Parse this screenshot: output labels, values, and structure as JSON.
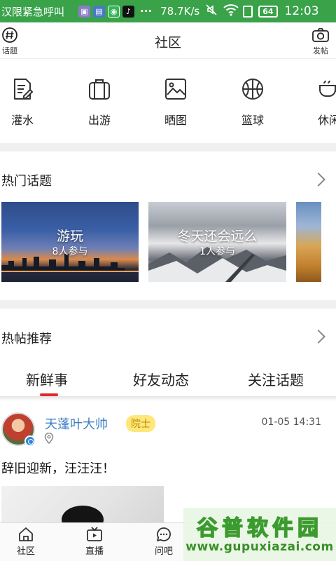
{
  "status_bar": {
    "ticker": "汉限紧急呼叫",
    "dots": "···",
    "speed": "78.7K/s",
    "battery": "64",
    "time": "12:03"
  },
  "header": {
    "title": "社区",
    "left_label": "话题",
    "right_label": "发帖"
  },
  "categories": [
    {
      "label": "灌水",
      "icon": "note-edit-icon"
    },
    {
      "label": "出游",
      "icon": "suitcase-icon"
    },
    {
      "label": "晒图",
      "icon": "image-icon"
    },
    {
      "label": "篮球",
      "icon": "basketball-icon"
    },
    {
      "label": "休闲",
      "icon": "cup-icon"
    }
  ],
  "hot_topics": {
    "title": "热门话题",
    "cards": [
      {
        "title": "游玩",
        "count": "8人参与"
      },
      {
        "title": "冬天还会远么",
        "count": "1人参与"
      }
    ]
  },
  "hot_posts": {
    "title": "热帖推荐",
    "tabs": [
      "新鲜事",
      "好友动态",
      "关注话题"
    ],
    "active_tab": 0
  },
  "post": {
    "author": "天蓬叶大帅",
    "rank": "院士",
    "time": "01-05 14:31",
    "text": "辞旧迎新，汪汪汪！"
  },
  "bottom_nav": [
    {
      "label": "社区",
      "icon": "home-icon"
    },
    {
      "label": "直播",
      "icon": "tv-icon"
    },
    {
      "label": "问吧",
      "icon": "chat-bubble-icon"
    }
  ],
  "watermark": {
    "title": "谷普软件园",
    "url": "www.gupuxiazai.com"
  },
  "colors": {
    "status_bar": "#3aa34a",
    "accent_red": "#e0292b",
    "author_blue": "#3c7fc5",
    "rank_yellow": "#ffe77a"
  }
}
